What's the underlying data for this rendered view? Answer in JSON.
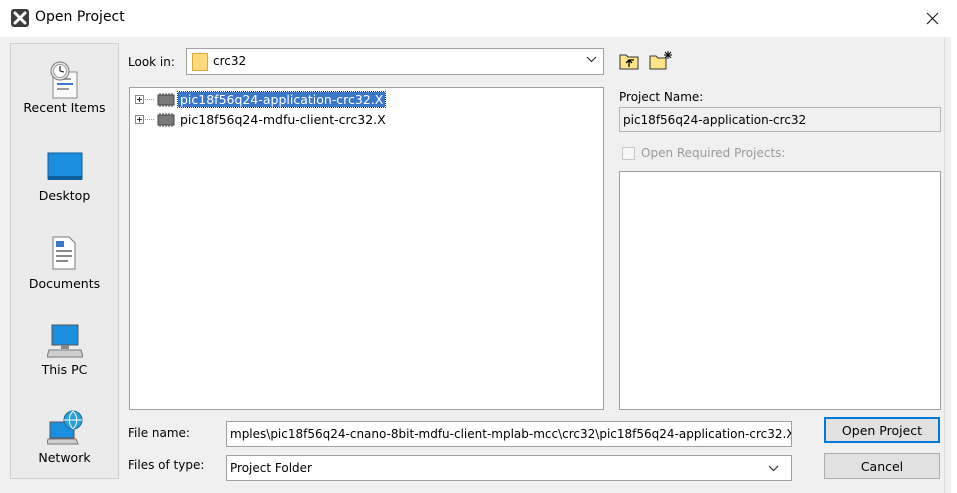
{
  "window": {
    "title": "Open Project",
    "icon": "app-logo-icon"
  },
  "places": [
    {
      "label": "Recent Items",
      "icon": "recent-items-icon"
    },
    {
      "label": "Desktop",
      "icon": "desktop-icon"
    },
    {
      "label": "Documents",
      "icon": "documents-icon"
    },
    {
      "label": "This PC",
      "icon": "this-pc-icon"
    },
    {
      "label": "Network",
      "icon": "network-icon"
    }
  ],
  "look_in": {
    "label": "Look in:",
    "value": "crc32"
  },
  "toolbar": {
    "up_icon": "up-one-level-icon",
    "new_folder_icon": "new-folder-icon"
  },
  "files": [
    {
      "name": "pic18f56q24-application-crc32.X",
      "selected": true
    },
    {
      "name": "pic18f56q24-mdfu-client-crc32.X",
      "selected": false
    }
  ],
  "project_name": {
    "label": "Project Name:",
    "value": "pic18f56q24-application-crc32"
  },
  "required": {
    "label": "Open Required Projects:",
    "checked": false
  },
  "file_name": {
    "label": "File name:",
    "value": "mples\\pic18f56q24-cnano-8bit-mdfu-client-mplab-mcc\\crc32\\pic18f56q24-application-crc32.X"
  },
  "file_type": {
    "label": "Files of type:",
    "value": "Project Folder"
  },
  "buttons": {
    "open": "Open Project",
    "cancel": "Cancel"
  },
  "colors": {
    "selection": "#3a77c8",
    "default_button_border": "#0078d7"
  }
}
